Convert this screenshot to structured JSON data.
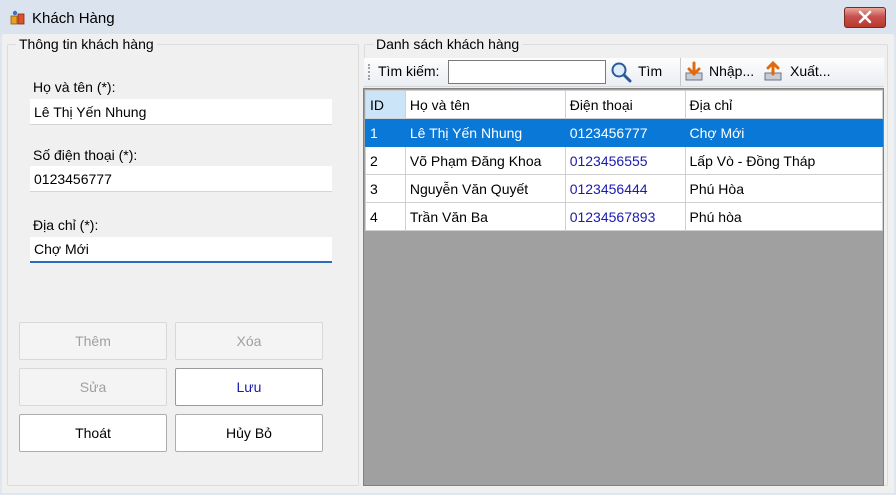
{
  "window": {
    "title": "Khách Hàng"
  },
  "left_group": {
    "legend": "Thông tin khách hàng",
    "name_label": "Họ và tên (*):",
    "name_value": "Lê Thị Yến Nhung",
    "phone_label": "Số điện thoại (*):",
    "phone_value": "0123456777",
    "address_label": "Địa chỉ (*):",
    "address_value": "Chợ Mới"
  },
  "buttons": {
    "add": "Thêm",
    "delete": "Xóa",
    "edit": "Sửa",
    "save": "Lưu",
    "exit": "Thoát",
    "cancel": "Hủy Bỏ"
  },
  "right_group": {
    "legend": "Danh sách khách hàng",
    "search_label": "Tìm kiếm:",
    "search_value": "",
    "find_label": "Tìm",
    "import_label": "Nhập...",
    "export_label": "Xuất..."
  },
  "table": {
    "headers": {
      "id": "ID",
      "name": "Họ và tên",
      "phone": "Điện thoại",
      "address": "Địa chỉ"
    },
    "rows": [
      {
        "id": "1",
        "name": "Lê Thị Yến Nhung",
        "phone": "0123456777",
        "address": "Chợ Mới"
      },
      {
        "id": "2",
        "name": "Võ Phạm Đăng Khoa",
        "phone": "0123456555",
        "address": "Lấp Vò - Đồng Tháp"
      },
      {
        "id": "3",
        "name": "Nguyễn Văn Quyết",
        "phone": "0123456444",
        "address": "Phú Hòa"
      },
      {
        "id": "4",
        "name": "Trần Văn Ba",
        "phone": "01234567893",
        "address": "Phú hòa"
      }
    ],
    "selected_row": 0
  },
  "colors": {
    "selection": "#0a78d7",
    "accent_text": "#1a1ab0",
    "focus_underline": "#2a6bbf"
  }
}
